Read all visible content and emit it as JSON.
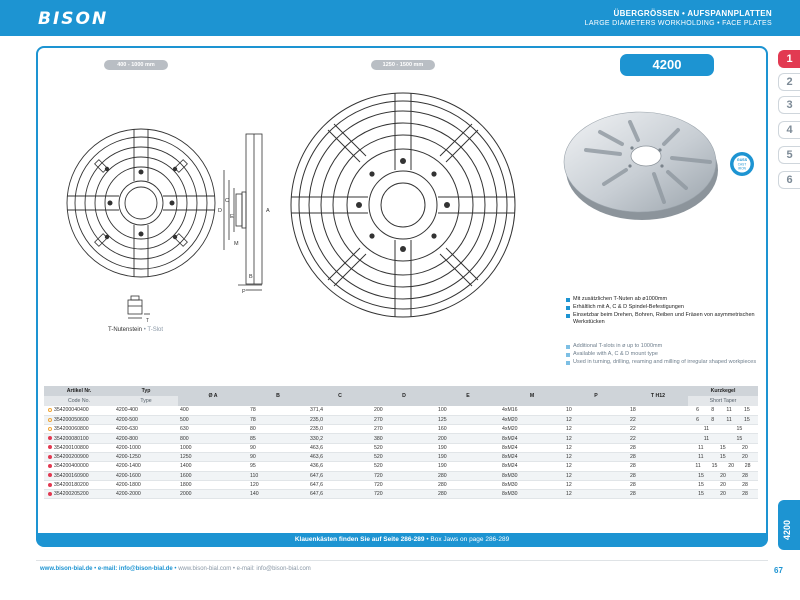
{
  "header": {
    "brand": "BISON",
    "title_de": "ÜBERGRÖSSEN • AUFSPANNPLATTEN",
    "title_en": "LARGE DIAMETERS WORKHOLDING • FACE PLATES"
  },
  "tabs": [
    "1",
    "2",
    "3",
    "4",
    "5",
    "6"
  ],
  "side_code": "4200",
  "model_badge": "4200",
  "size_pill_small": "400 - 1000 mm",
  "size_pill_large": "1250 - 1500 mm",
  "dim_letters": {
    "a": "A",
    "b": "B",
    "c": "C",
    "d": "D",
    "e": "E",
    "m": "M",
    "p": "P",
    "t": "T"
  },
  "slot_caption": {
    "de": "T-Nutenstein",
    "sep": " • ",
    "en": "T-Slot"
  },
  "cast_badge": {
    "line1": "GUSS",
    "line2": "CAST",
    "line3": "IRON"
  },
  "bullets_de": [
    "Mit zusätzlichen T-Nuten ab ø1000mm",
    "Erhältlich mit A, C & D Spindel-Befestigungen",
    "Einsetzbar beim Drehen, Bohren, Reiben und Fräsen von asymmetrischen Werkstücken"
  ],
  "bullets_en": [
    "Additional T-slots in ø up to 1000mm",
    "Available with A, C & D mount type",
    "Used in turning, drilling, reaming and milling of irregular shaped workpieces"
  ],
  "table": {
    "head_de": [
      "Artikel Nr.",
      "Typ",
      "Ø A",
      "B",
      "C",
      "D",
      "E",
      "M",
      "P",
      "T H12",
      "Kurzkegel"
    ],
    "head_en": [
      "Code No.",
      "Type",
      "Short Taper"
    ],
    "rows": [
      {
        "code": "354200040400",
        "marker": "hollow",
        "type": "4200-400",
        "a": "400",
        "b": "78",
        "c": "371,4",
        "d": "200",
        "e": "100",
        "m": "4xM16",
        "p": "10",
        "t": "18",
        "taper": [
          "6",
          "8",
          "11",
          "15"
        ]
      },
      {
        "code": "354200050600",
        "marker": "hollow",
        "type": "4200-500",
        "a": "500",
        "b": "78",
        "c": "235,0",
        "d": "270",
        "e": "125",
        "m": "4xM20",
        "p": "12",
        "t": "22",
        "taper": [
          "6",
          "8",
          "11",
          "15"
        ]
      },
      {
        "code": "354200060800",
        "marker": "hollow",
        "type": "4200-630",
        "a": "630",
        "b": "80",
        "c": "235,0",
        "d": "270",
        "e": "160",
        "m": "4xM20",
        "p": "12",
        "t": "22",
        "taper": [
          "11",
          "15"
        ]
      },
      {
        "code": "354200080100",
        "marker": "red",
        "type": "4200-800",
        "a": "800",
        "b": "85",
        "c": "330,2",
        "d": "380",
        "e": "200",
        "m": "8xM24",
        "p": "12",
        "t": "22",
        "taper": [
          "11",
          "15"
        ]
      },
      {
        "code": "354200100800",
        "marker": "red",
        "type": "4200-1000",
        "a": "1000",
        "b": "90",
        "c": "463,6",
        "d": "520",
        "e": "190",
        "m": "8xM24",
        "p": "12",
        "t": "28",
        "taper": [
          "11",
          "15",
          "20"
        ]
      },
      {
        "code": "354200200900",
        "marker": "red",
        "type": "4200-1250",
        "a": "1250",
        "b": "90",
        "c": "463,6",
        "d": "520",
        "e": "190",
        "m": "8xM24",
        "p": "12",
        "t": "28",
        "taper": [
          "11",
          "15",
          "20"
        ]
      },
      {
        "code": "354200400000",
        "marker": "red",
        "type": "4200-1400",
        "a": "1400",
        "b": "95",
        "c": "436,6",
        "d": "520",
        "e": "190",
        "m": "8xM24",
        "p": "12",
        "t": "28",
        "taper": [
          "11",
          "15",
          "20",
          "28"
        ]
      },
      {
        "code": "354200160900",
        "marker": "red",
        "type": "4200-1600",
        "a": "1600",
        "b": "110",
        "c": "647,6",
        "d": "720",
        "e": "280",
        "m": "8xM30",
        "p": "12",
        "t": "28",
        "taper": [
          "15",
          "20",
          "28"
        ]
      },
      {
        "code": "354200180200",
        "marker": "red",
        "type": "4200-1800",
        "a": "1800",
        "b": "120",
        "c": "647,6",
        "d": "720",
        "e": "280",
        "m": "8xM30",
        "p": "12",
        "t": "28",
        "taper": [
          "15",
          "20",
          "28"
        ]
      },
      {
        "code": "354200205200",
        "marker": "red",
        "type": "4200-2000",
        "a": "2000",
        "b": "140",
        "c": "647,6",
        "d": "720",
        "e": "280",
        "m": "8xM30",
        "p": "12",
        "t": "28",
        "taper": [
          "15",
          "20",
          "28"
        ]
      }
    ]
  },
  "footband": {
    "de": "Klauenkästen finden Sie auf Seite 286-289",
    "sep": " • ",
    "en": "Box Jaws on page 286-289"
  },
  "footer": {
    "www_bold": "www.bison-bial.de",
    "sep1": " • ",
    "mail_bold": "e-mail: info@bison-bial.de",
    "sep2": " • ",
    "www_com": "www.bison-bial.com",
    "sep3": " • ",
    "mail_com": "e-mail: info@bison-bial.com"
  },
  "page_number": "67",
  "colors": {
    "brand_blue": "#1d94d2",
    "accent_red": "#e23a52",
    "marker_orange": "#f0a534"
  }
}
